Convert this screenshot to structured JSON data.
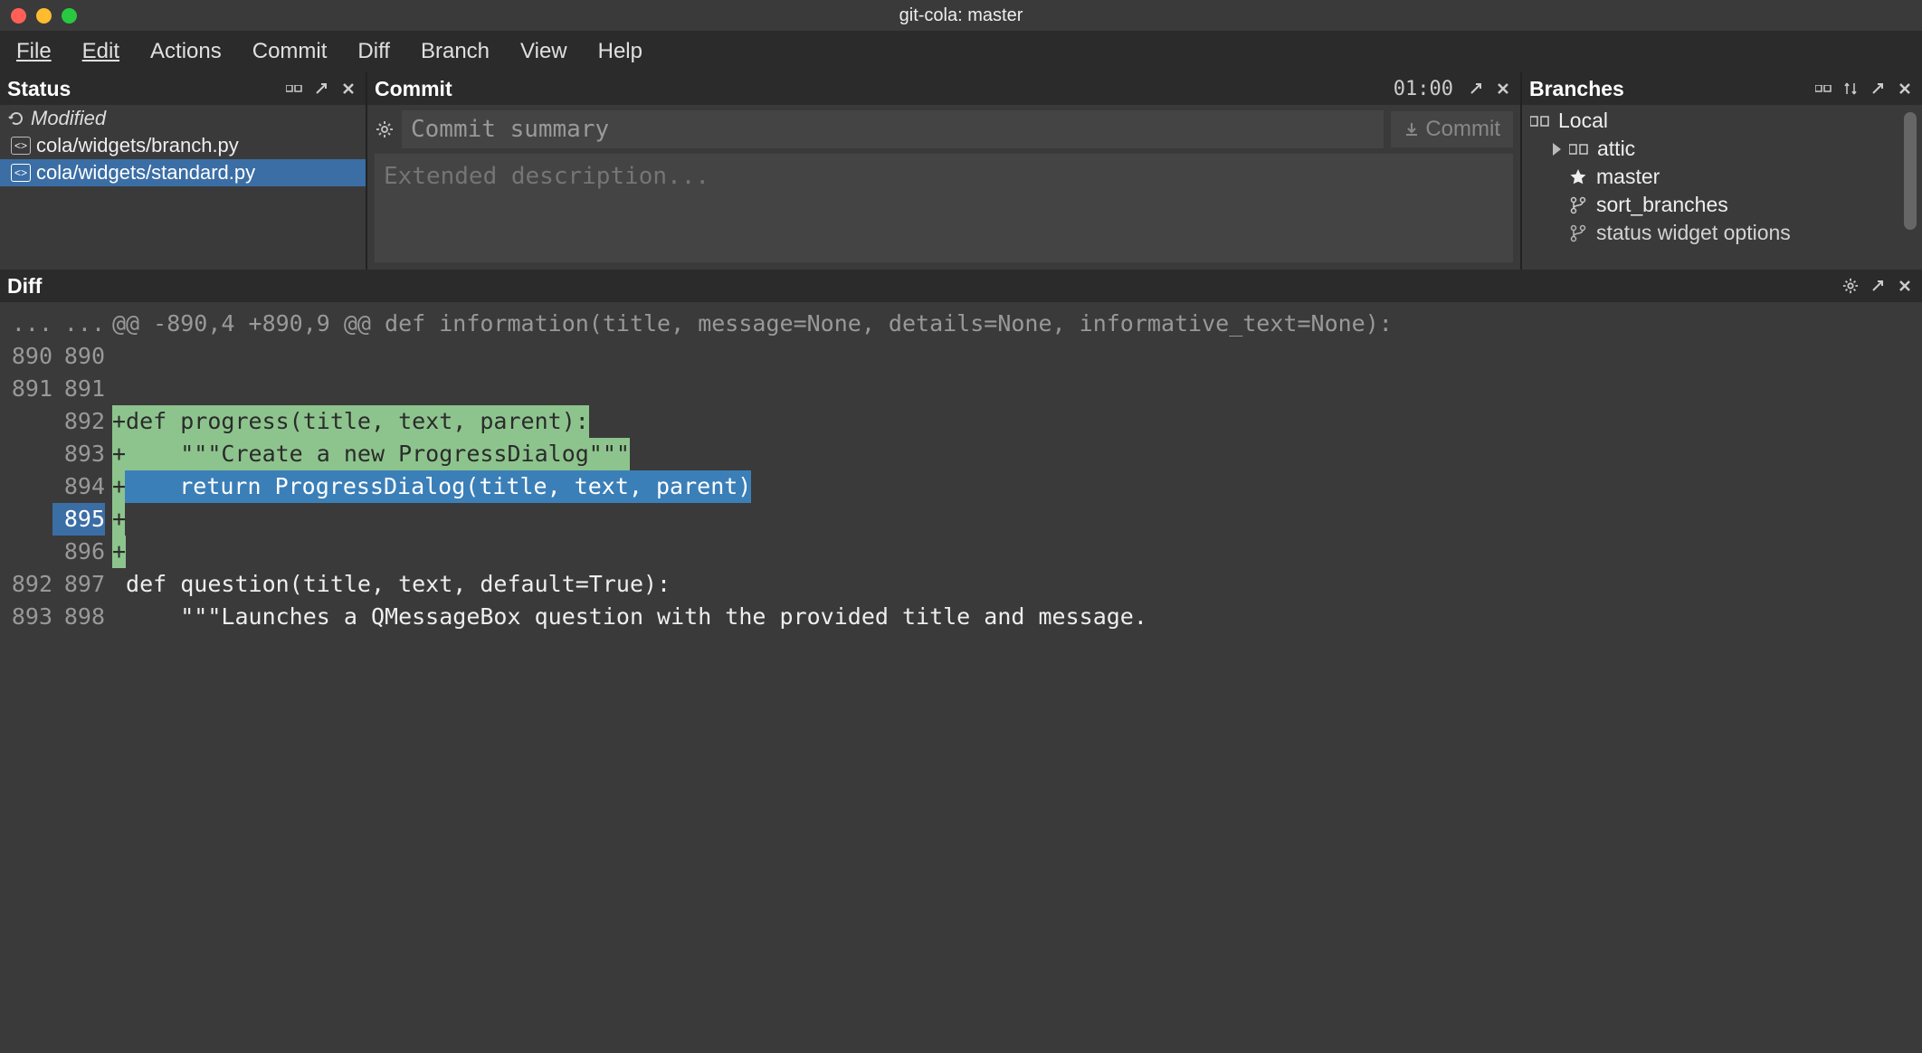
{
  "title": "git-cola: master",
  "menu": [
    "File",
    "Edit",
    "Actions",
    "Commit",
    "Diff",
    "Branch",
    "View",
    "Help"
  ],
  "status": {
    "title": "Status",
    "modified_label": "Modified",
    "files": [
      {
        "path": "cola/widgets/branch.py",
        "selected": false
      },
      {
        "path": "cola/widgets/standard.py",
        "selected": true
      }
    ]
  },
  "commit": {
    "title": "Commit",
    "time": "01:00",
    "summary_placeholder": "Commit summary",
    "desc_placeholder": "Extended description...",
    "button_label": "Commit"
  },
  "branches": {
    "title": "Branches",
    "local_label": "Local",
    "items": [
      {
        "name": "attic",
        "kind": "folder"
      },
      {
        "name": "master",
        "kind": "star"
      },
      {
        "name": "sort_branches",
        "kind": "branch"
      },
      {
        "name": "status widget options",
        "kind": "branch"
      }
    ]
  },
  "diff": {
    "title": "Diff",
    "lines": [
      {
        "old": "...",
        "new": "...",
        "type": "hunk",
        "text": "@@ -890,4 +890,9 @@ def information(title, message=None, details=None, informative_text=None):"
      },
      {
        "old": "890",
        "new": "890",
        "type": "ctx",
        "text": ""
      },
      {
        "old": "891",
        "new": "891",
        "type": "ctx",
        "text": ""
      },
      {
        "old": "",
        "new": "892",
        "type": "add",
        "text": "+def progress(title, text, parent):"
      },
      {
        "old": "",
        "new": "893",
        "type": "add",
        "text": "+    \"\"\"Create a new ProgressDialog\"\"\""
      },
      {
        "old": "",
        "new": "894",
        "type": "add-sel",
        "text": "+    return ProgressDialog(title, text, parent)"
      },
      {
        "old": "",
        "new": "895",
        "type": "add-cur",
        "text": "+"
      },
      {
        "old": "",
        "new": "896",
        "type": "add",
        "text": "+"
      },
      {
        "old": "892",
        "new": "897",
        "type": "ctx",
        "text": " def question(title, text, default=True):"
      },
      {
        "old": "893",
        "new": "898",
        "type": "ctx",
        "text": "     \"\"\"Launches a QMessageBox question with the provided title and message."
      }
    ]
  }
}
